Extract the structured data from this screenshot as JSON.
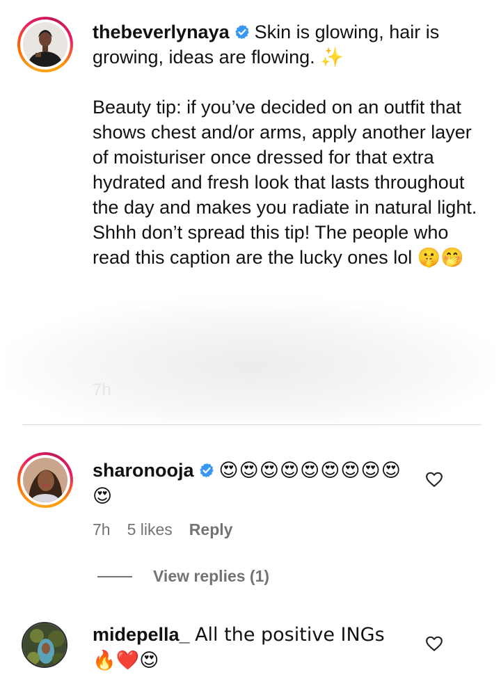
{
  "post": {
    "username": "thebeverlynaya",
    "caption": "Skin is glowing, hair is growing, ideas are flowing. ✨\n\nBeauty tip: if you’ve decided on an outfit that shows chest and/or arms, apply another layer of moisturiser once dressed for that extra hydrated and fresh look that lasts throughout the day and makes you radiate in natural light. Shhh don’t spread this tip! The people who read this caption are the lucky ones lol 🤫🤭",
    "time": "7h"
  },
  "comments": [
    {
      "username": "sharonooja",
      "text": "😍😍😍😍😍😍😍😍😍😍",
      "time": "7h",
      "likes": "5 likes",
      "reply_label": "Reply",
      "view_replies": "View replies (1)"
    },
    {
      "username": "midepella_",
      "text": "All the positive INGs 🔥❤️😍"
    }
  ],
  "colors": {
    "verified": "#3897f0",
    "muted": "#737373",
    "divider": "#dbdbdb"
  },
  "icons": {
    "verified": "verified-badge-icon",
    "like": "heart-outline-icon"
  }
}
